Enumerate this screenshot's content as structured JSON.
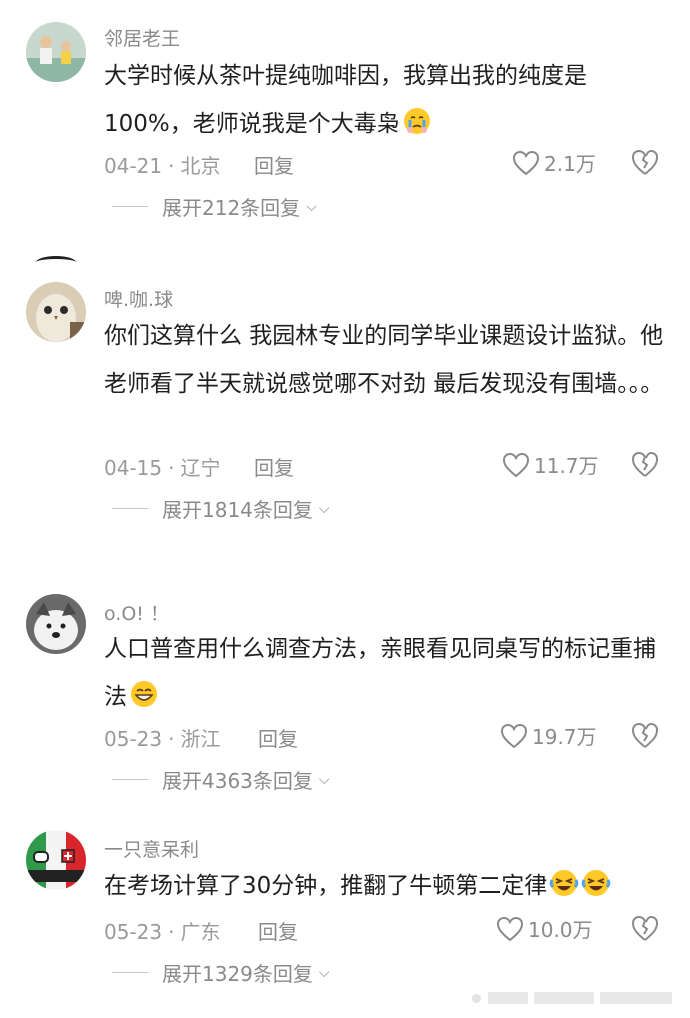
{
  "comments": [
    {
      "username": "邻居老王",
      "text": "大学时候从茶叶提纯咖啡因，我算出我的纯度是100%，老师说我是个大毒枭",
      "emoji": "crying-face",
      "date": "04-21",
      "location": "北京",
      "reply_label": "回复",
      "likes": "2.1万",
      "expand_label": "展开212条回复"
    },
    {
      "username": "啤.咖.球",
      "text": "你们这算什么 我园林专业的同学毕业课题设计监狱。他老师看了半天就说感觉哪不对劲 最后发现没有围墙。。。",
      "date": "04-15",
      "location": "辽宁",
      "reply_label": "回复",
      "likes": "11.7万",
      "expand_label": "展开1814条回复"
    },
    {
      "username": "o.O! ！",
      "text": "人口普查用什么调查方法，亲眼看见同桌写的标记重捕法",
      "emoji": "grinning-face",
      "date": "05-23",
      "location": "浙江",
      "reply_label": "回复",
      "likes": "19.7万",
      "expand_label": "展开4363条回复"
    },
    {
      "username": "一只意呆利",
      "text": "在考场计算了30分钟，推翻了牛顿第二定律",
      "emoji": "laughing-crying-face",
      "date": "05-23",
      "location": "广东",
      "reply_label": "回复",
      "likes": "10.0万",
      "expand_label": "展开1329条回复"
    }
  ],
  "colors": {
    "text": "#1f1f1f",
    "muted": "#9a9a9a",
    "emoji_yellow": "#ffca28"
  }
}
